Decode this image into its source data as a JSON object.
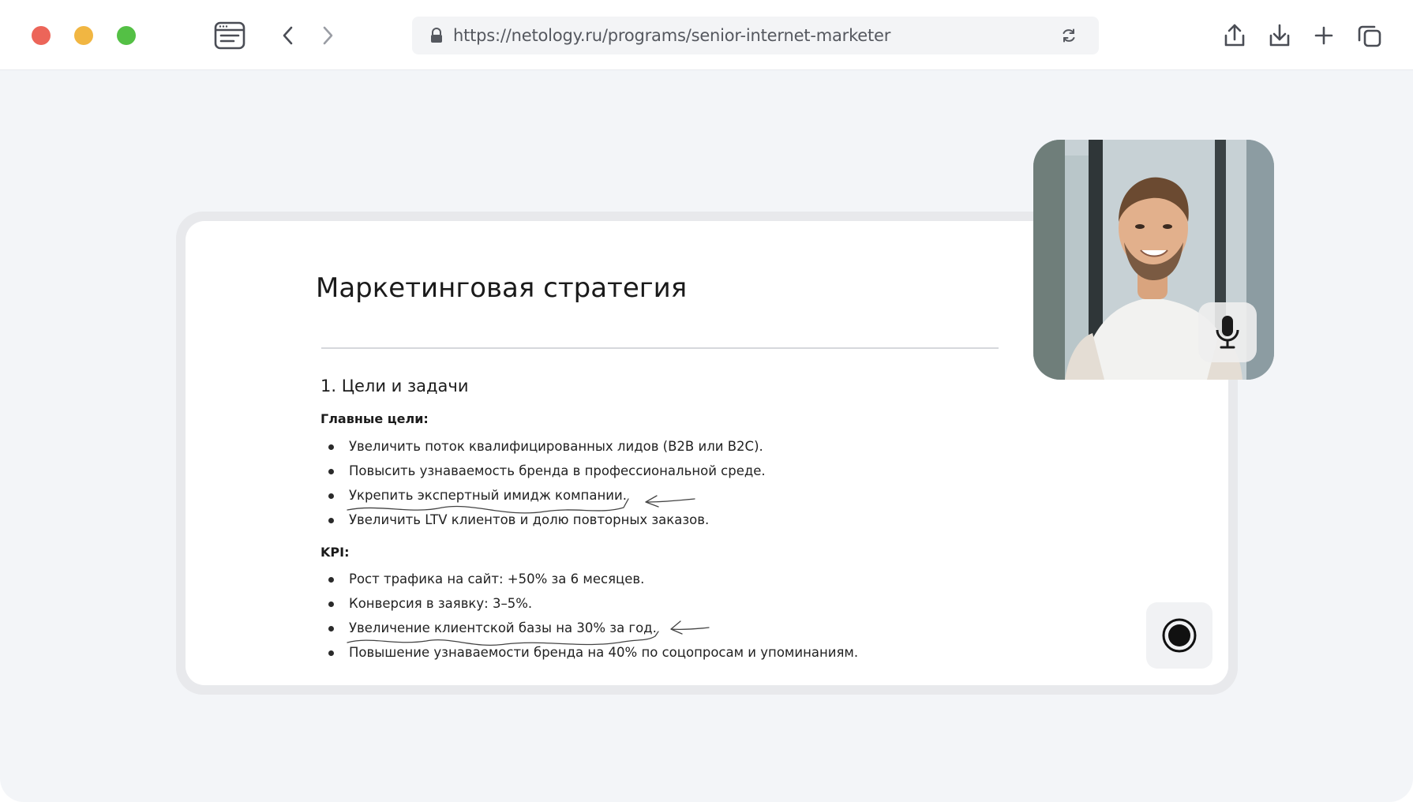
{
  "browser": {
    "url": "https://netology.ru/programs/senior-internet-marketer",
    "icons": {
      "sidebar": "sidebar-icon",
      "back": "chevron-left-icon",
      "forward": "chevron-right-icon",
      "lock": "lock-icon",
      "reload": "reload-icon",
      "share": "share-icon",
      "download": "download-icon",
      "new_tab": "plus-icon",
      "tabs": "tabs-overview-icon"
    },
    "traffic_lights": [
      "#ec6559",
      "#f1b642",
      "#54c045"
    ]
  },
  "slide": {
    "title": "Маркетинговая стратегия",
    "section_heading": "1. Цели и задачи",
    "goals_label": "Главные цели:",
    "goals": [
      "Увеличить поток квалифицированных лидов (B2B или B2C).",
      "Повысить узнаваемость бренда в профессиональной среде.",
      "Укрепить экспертный имидж компании.",
      "Увеличить LTV клиентов и долю повторных заказов."
    ],
    "kpi_label": "KPI:",
    "kpis": [
      "Рост трафика на сайт: +50% за 6 месяцев.",
      "Конверсия в заявку: 3–5%.",
      "Увеличение клиентской базы на 30% за год.",
      "Повышение узнаваемости бренда на 40% по соцопросам и упоминаниям."
    ]
  },
  "camera": {
    "mic_icon": "microphone-icon",
    "record_icon": "record-icon"
  }
}
